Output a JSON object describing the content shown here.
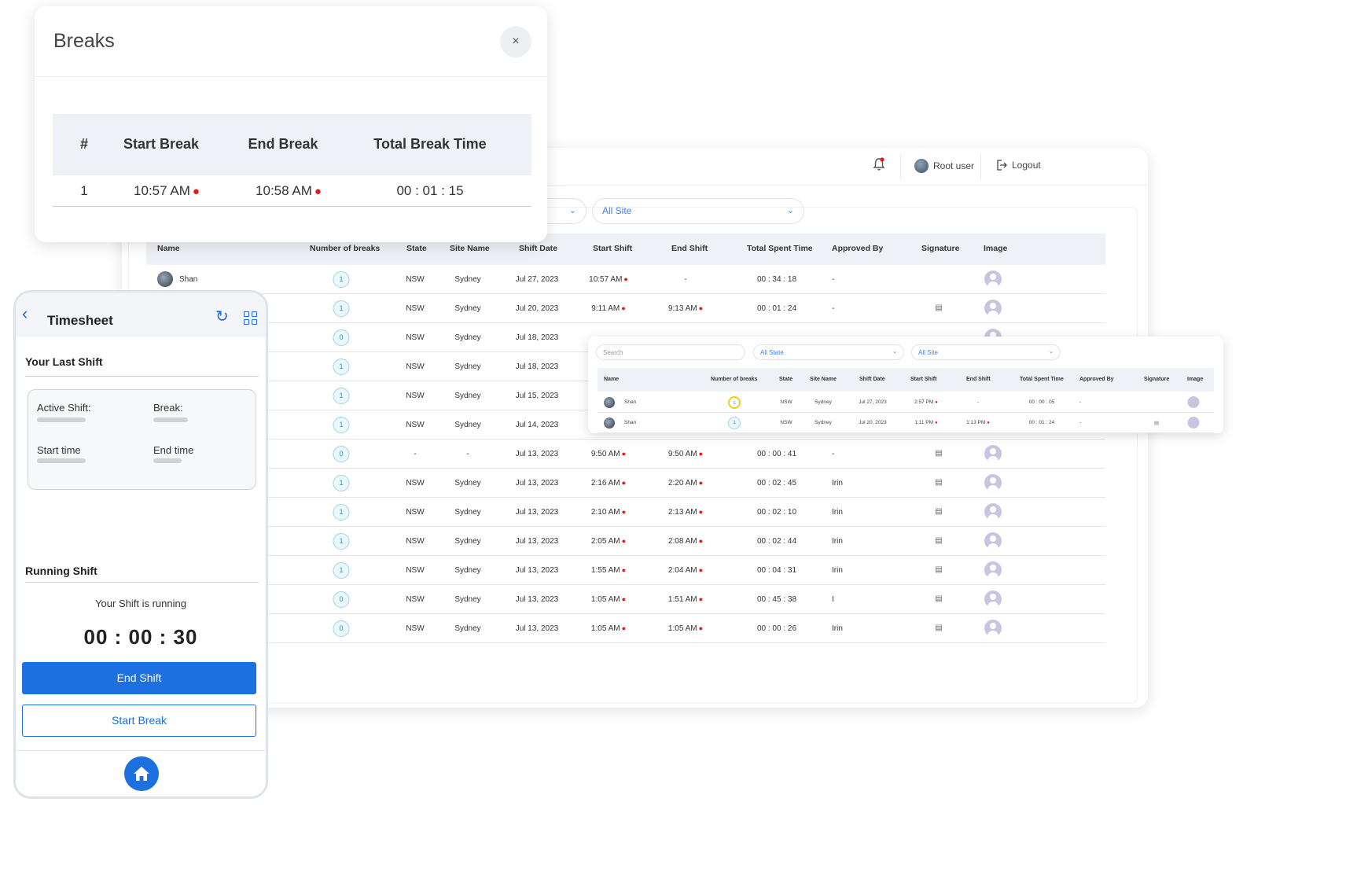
{
  "breaks_modal": {
    "title": "Breaks",
    "close": "×",
    "headers": [
      "#",
      "Start Break",
      "End Break",
      "Total Break Time"
    ],
    "rows": [
      {
        "num": "1",
        "start": "10:57 AM",
        "end": "10:58 AM",
        "total": "00 : 01 : 15"
      }
    ]
  },
  "topbar": {
    "user": "Root user",
    "logout": "Logout"
  },
  "filters": {
    "site": "All Site"
  },
  "table": {
    "headers": [
      "Name",
      "Number of breaks",
      "State",
      "Site Name",
      "Shift Date",
      "Start Shift",
      "End Shift",
      "Total Spent Time",
      "Approved By",
      "Signature",
      "Image"
    ],
    "rows": [
      {
        "name": "Shan",
        "breaks": "1",
        "state": "NSW",
        "site": "Sydney",
        "date": "Jul 27, 2023",
        "start": "10:57 AM",
        "end": "-",
        "total": "00 : 34 : 18",
        "approved": "-",
        "sig": false
      },
      {
        "name": "",
        "breaks": "1",
        "state": "NSW",
        "site": "Sydney",
        "date": "Jul 20, 2023",
        "start": "9:11 AM",
        "end": "9:13 AM",
        "total": "00 : 01 : 24",
        "approved": "-",
        "sig": true
      },
      {
        "name": "",
        "breaks": "0",
        "state": "NSW",
        "site": "Sydney",
        "date": "Jul 18, 2023",
        "start": "",
        "end": "",
        "total": "",
        "approved": "",
        "sig": false
      },
      {
        "name": "",
        "breaks": "1",
        "state": "NSW",
        "site": "Sydney",
        "date": "Jul 18, 2023",
        "start": "",
        "end": "",
        "total": "",
        "approved": "",
        "sig": false
      },
      {
        "name": "",
        "breaks": "1",
        "state": "NSW",
        "site": "Sydney",
        "date": "Jul 15, 2023",
        "start": "",
        "end": "",
        "total": "",
        "approved": "",
        "sig": false
      },
      {
        "name": "",
        "breaks": "1",
        "state": "NSW",
        "site": "Sydney",
        "date": "Jul 14, 2023",
        "start": "",
        "end": "",
        "total": "",
        "approved": "",
        "sig": false
      },
      {
        "name": "",
        "breaks": "0",
        "state": "-",
        "site": "-",
        "date": "Jul 13, 2023",
        "start": "9:50 AM",
        "end": "9:50 AM",
        "total": "00 : 00 : 41",
        "approved": "-",
        "sig": true
      },
      {
        "name": "",
        "breaks": "1",
        "state": "NSW",
        "site": "Sydney",
        "date": "Jul 13, 2023",
        "start": "2:16 AM",
        "end": "2:20 AM",
        "total": "00 : 02 : 45",
        "approved": "Irin",
        "sig": true
      },
      {
        "name": "",
        "breaks": "1",
        "state": "NSW",
        "site": "Sydney",
        "date": "Jul 13, 2023",
        "start": "2:10 AM",
        "end": "2:13 AM",
        "total": "00 : 02 : 10",
        "approved": "Irin",
        "sig": true
      },
      {
        "name": "",
        "breaks": "1",
        "state": "NSW",
        "site": "Sydney",
        "date": "Jul 13, 2023",
        "start": "2:05 AM",
        "end": "2:08 AM",
        "total": "00 : 02 : 44",
        "approved": "Irin",
        "sig": true
      },
      {
        "name": "",
        "breaks": "1",
        "state": "NSW",
        "site": "Sydney",
        "date": "Jul 13, 2023",
        "start": "1:55 AM",
        "end": "2:04 AM",
        "total": "00 : 04 : 31",
        "approved": "Irin",
        "sig": true
      },
      {
        "name": "",
        "breaks": "0",
        "state": "NSW",
        "site": "Sydney",
        "date": "Jul 13, 2023",
        "start": "1:05 AM",
        "end": "1:51 AM",
        "total": "00 : 45 : 38",
        "approved": "I",
        "sig": true
      },
      {
        "name": "",
        "breaks": "0",
        "state": "NSW",
        "site": "Sydney",
        "date": "Jul 13, 2023",
        "start": "1:05 AM",
        "end": "1:05 AM",
        "total": "00 : 00 : 26",
        "approved": "Irin",
        "sig": true
      }
    ]
  },
  "mini": {
    "search_placeholder": "Search",
    "state": "All State",
    "site": "All Site",
    "headers": [
      "Name",
      "Number of breaks",
      "State",
      "Site Name",
      "Shift Date",
      "Start Shift",
      "End Shift",
      "Total Spent Time",
      "Approved By",
      "Signature",
      "Image"
    ],
    "rows": [
      {
        "name": "Shan",
        "breaks": "1",
        "state": "NSW",
        "site": "Sydney",
        "date": "Jul 27, 2023",
        "start": "2:57 PM",
        "end": "-",
        "total": "00 : 00 : 05",
        "approved": "-",
        "sig": false,
        "highlight": true
      },
      {
        "name": "Shan",
        "breaks": "1",
        "state": "NSW",
        "site": "Sydney",
        "date": "Jul 20, 2023",
        "start": "1:11 PM",
        "end": "1:13 PM",
        "total": "00 : 01 : 24",
        "approved": "-",
        "sig": true,
        "highlight": false
      }
    ]
  },
  "phone": {
    "title": "Timesheet",
    "last_shift": "Your Last Shift",
    "active_shift": "Active Shift:",
    "break": "Break:",
    "start_time": "Start time",
    "end_time": "End time",
    "running_shift": "Running Shift",
    "running_text": "Your Shift is running",
    "timer": "00 : 00 : 30",
    "end_shift": "End Shift",
    "start_break": "Start Break"
  },
  "icons": {
    "bell": "bell-icon",
    "pin": "map-pin-icon",
    "signature": "signature-icon",
    "home": "home-icon"
  },
  "colors": {
    "primary": "#1e6fe0",
    "pin": "#e0191f",
    "highlight": "#f1cc1d"
  }
}
